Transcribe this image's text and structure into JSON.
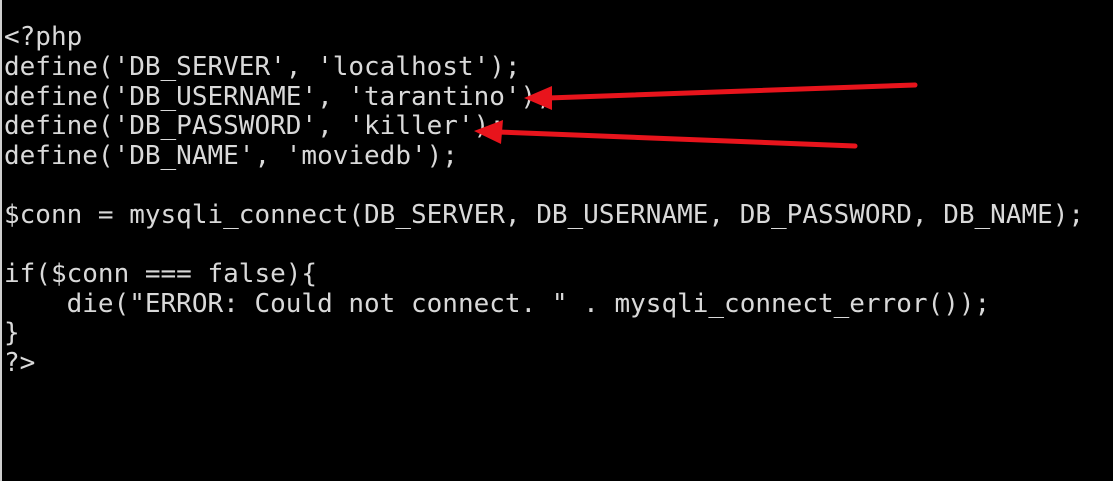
{
  "console": {
    "lines": [
      "<?php",
      "define('DB_SERVER', 'localhost');",
      "define('DB_USERNAME', 'tarantino');",
      "define('DB_PASSWORD', 'killer');",
      "define('DB_NAME', 'moviedb');",
      "",
      "$conn = mysqli_connect(DB_SERVER, DB_USERNAME, DB_PASSWORD, DB_NAME);",
      "",
      "if($conn === false){",
      "    die(\"ERROR: Could not connect. \" . mysqli_connect_error());",
      "}",
      "?>"
    ]
  },
  "colors": {
    "background": "#000000",
    "text": "#d9d9d9",
    "arrow": "#e8141c"
  }
}
